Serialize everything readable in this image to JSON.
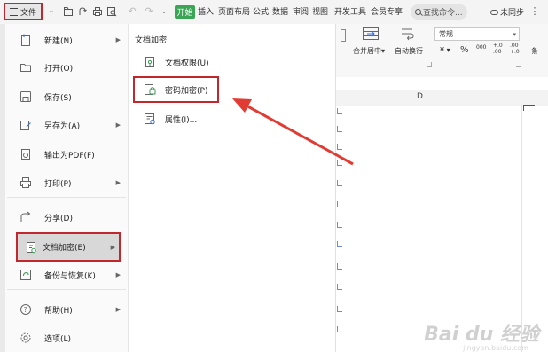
{
  "toolbar": {
    "file_label": "文件",
    "start_tab": "开始",
    "tabs": [
      "插入",
      "页面布局",
      "公式",
      "数据",
      "审阅",
      "视图",
      "开发工具",
      "会员专享"
    ],
    "search_placeholder": "查找命令...",
    "sync_label": "未同步"
  },
  "ribbon": {
    "number_format": "常规",
    "merge_label": "合并居中",
    "wrap_label": "自动换行",
    "currency_symbol": "¥",
    "percent_symbol": "%",
    "thousands_symbol": "000",
    "inc_decimal": "+.0 .00",
    "dec_decimal": ".00 +.0",
    "cond_label": "条"
  },
  "sheet": {
    "column_label": "D"
  },
  "file_menu": {
    "items": [
      {
        "label": "新建(N)",
        "icon": "new-doc-icon",
        "has_submenu": true
      },
      {
        "label": "打开(O)",
        "icon": "folder-icon",
        "has_submenu": false
      },
      {
        "label": "保存(S)",
        "icon": "save-icon",
        "has_submenu": false
      },
      {
        "label": "另存为(A)",
        "icon": "save-as-icon",
        "has_submenu": true
      },
      {
        "label": "输出为PDF(F)",
        "icon": "pdf-icon",
        "has_submenu": false
      },
      {
        "label": "打印(P)",
        "icon": "print-icon",
        "has_submenu": true
      },
      {
        "label": "分享(D)",
        "icon": "share-icon",
        "has_submenu": false
      },
      {
        "label": "文档加密(E)",
        "icon": "encrypt-doc-icon",
        "has_submenu": true,
        "selected": true
      },
      {
        "label": "备份与恢复(K)",
        "icon": "backup-icon",
        "has_submenu": true
      },
      {
        "label": "帮助(H)",
        "icon": "help-icon",
        "has_submenu": true
      },
      {
        "label": "选项(L)",
        "icon": "gear-icon",
        "has_submenu": false
      }
    ]
  },
  "submenu": {
    "title": "文档加密",
    "items": [
      {
        "label": "文档权限(U)",
        "icon": "doc-permission-icon"
      },
      {
        "label": "密码加密(P)",
        "icon": "password-lock-icon",
        "highlighted": true
      },
      {
        "label": "属性(I)...",
        "icon": "properties-icon"
      }
    ]
  },
  "watermark": {
    "brand": "Bai du 经验",
    "url": "jingyan.baidu.com"
  },
  "colors": {
    "highlight_border": "#c0282d",
    "start_tab_bg": "#3aa655",
    "arrow": "#e23b33"
  }
}
